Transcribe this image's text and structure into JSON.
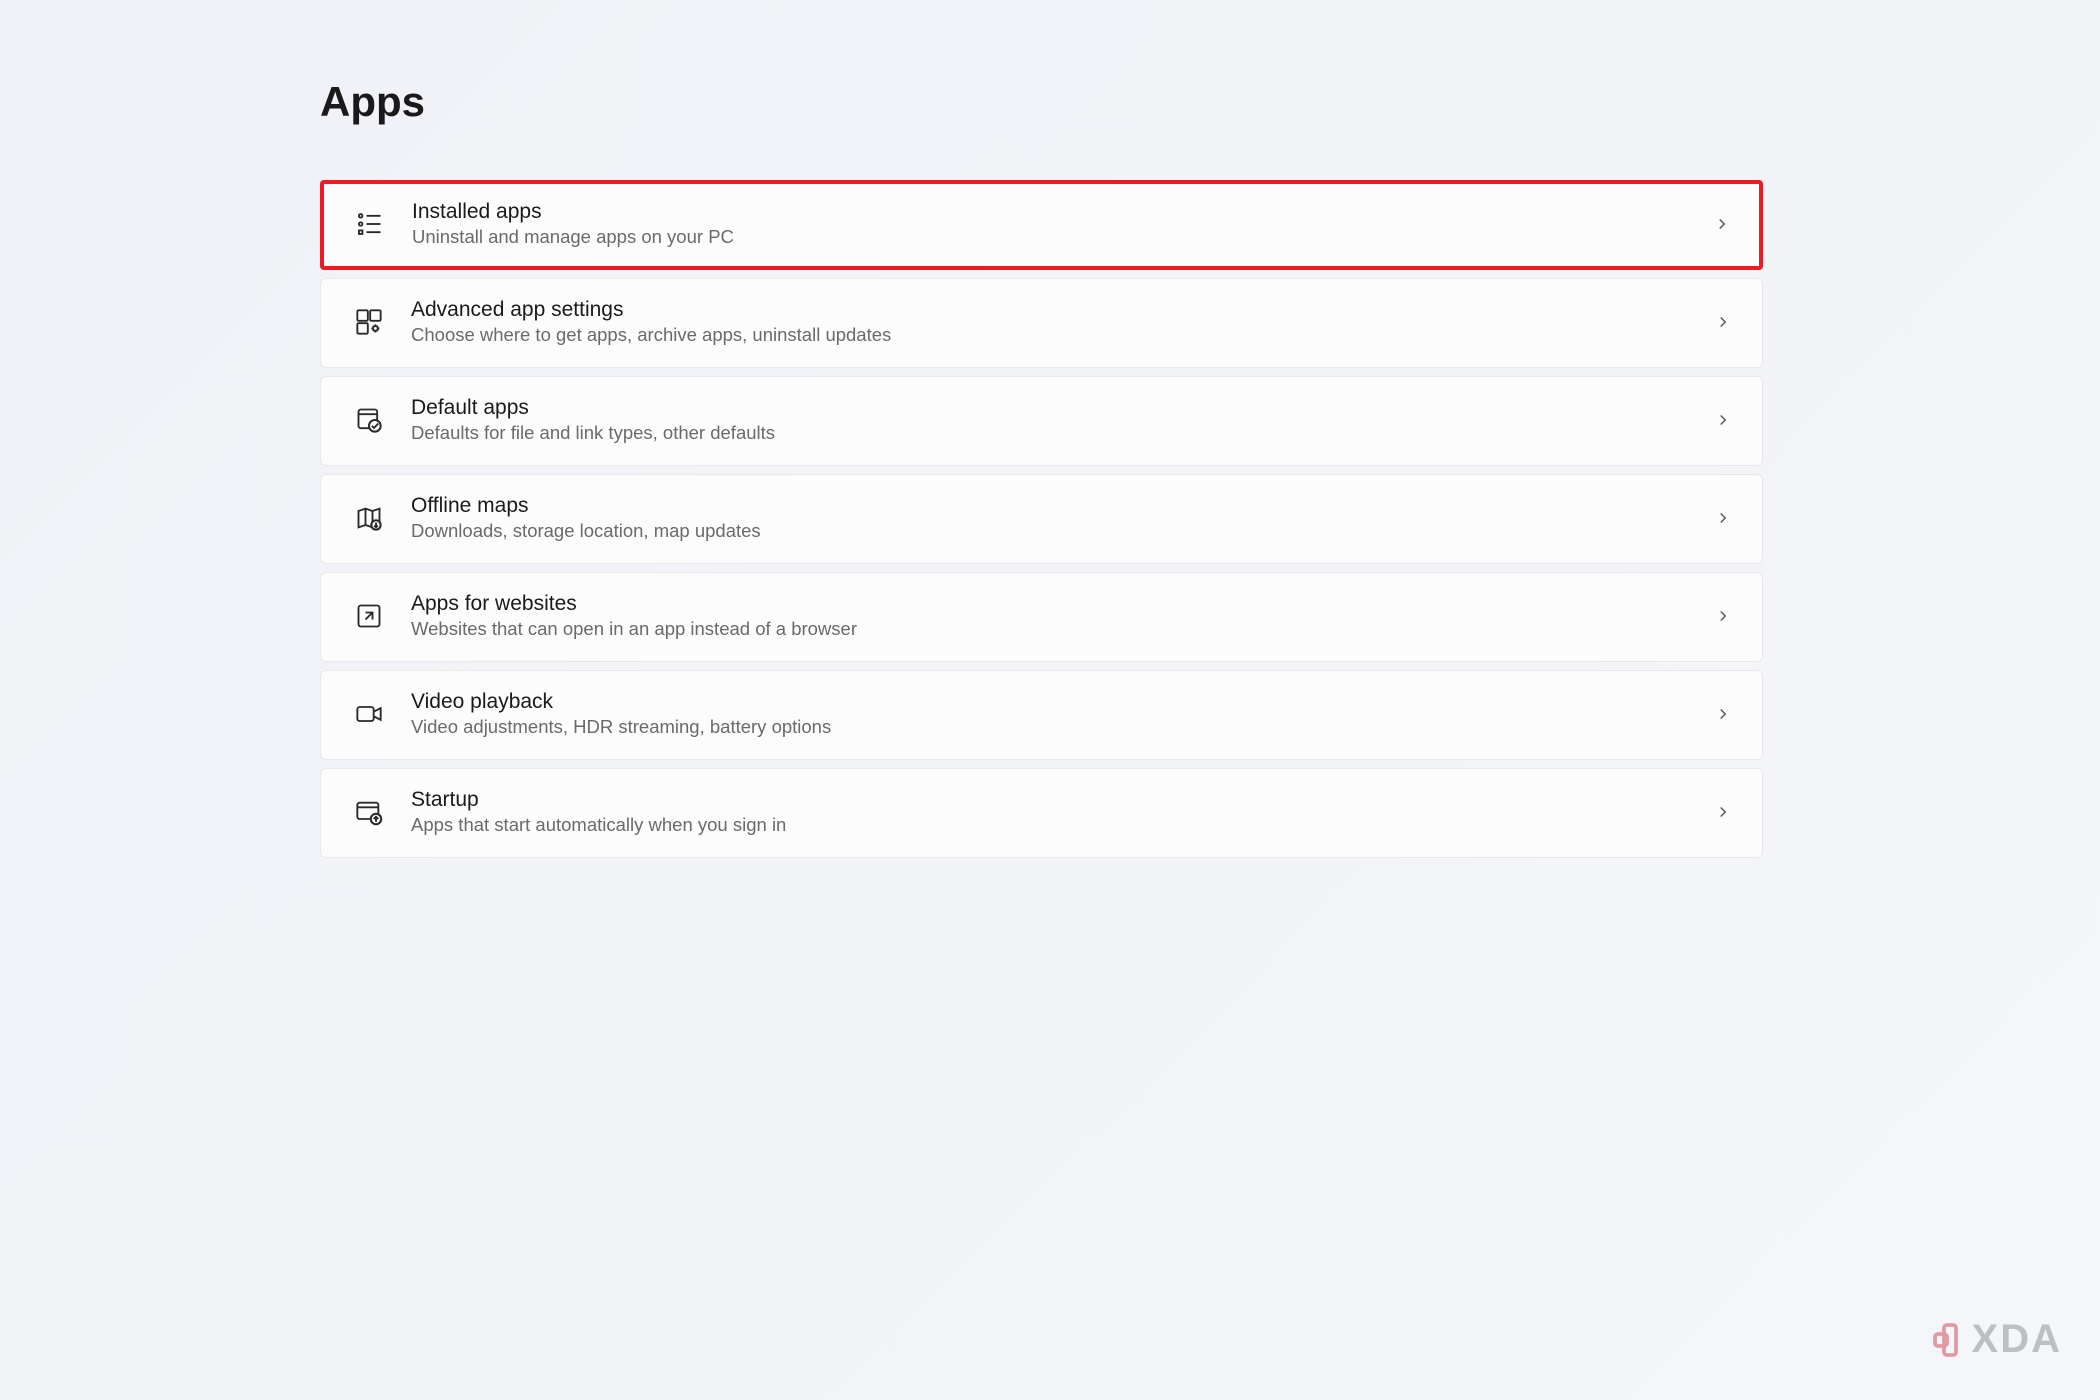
{
  "page": {
    "title": "Apps"
  },
  "items": [
    {
      "title": "Installed apps",
      "description": "Uninstall and manage apps on your PC",
      "highlighted": true
    },
    {
      "title": "Advanced app settings",
      "description": "Choose where to get apps, archive apps, uninstall updates",
      "highlighted": false
    },
    {
      "title": "Default apps",
      "description": "Defaults for file and link types, other defaults",
      "highlighted": false
    },
    {
      "title": "Offline maps",
      "description": "Downloads, storage location, map updates",
      "highlighted": false
    },
    {
      "title": "Apps for websites",
      "description": "Websites that can open in an app instead of a browser",
      "highlighted": false
    },
    {
      "title": "Video playback",
      "description": "Video adjustments, HDR streaming, battery options",
      "highlighted": false
    },
    {
      "title": "Startup",
      "description": "Apps that start automatically when you sign in",
      "highlighted": false
    }
  ],
  "watermark": {
    "text": "XDA"
  }
}
